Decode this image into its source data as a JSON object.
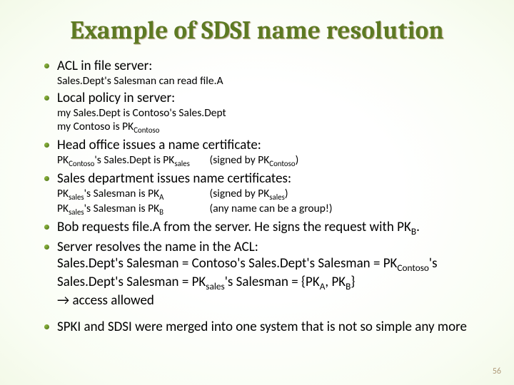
{
  "title": "Example of SDSI name resolution",
  "items": {
    "p0": "ACL in file server:",
    "s0": "Sales.Dept's Salesman can read file.A",
    "p1": "Local policy in server:",
    "s1a": "my Sales.Dept is Contoso's Sales.Dept",
    "s1b_pre": "my Contoso is PK",
    "s1b_sub": "Contoso",
    "p2": "Head office issues a name certificate:",
    "s2a_t1": "PK",
    "s2a_sub1": "Contoso",
    "s2a_t2": "'s Sales.Dept is PK",
    "s2a_sub2": "sales",
    "s2a_t3": "(signed by PK",
    "s2a_sub3": "Contoso",
    "s2a_t4": ")",
    "p3": "Sales department issues name certificates:",
    "s3a_t1": "PK",
    "s3a_sub1": "sales",
    "s3a_t2": "'s Salesman is PK",
    "s3a_sub2": "A",
    "s3a_t3": "(signed by PK",
    "s3a_sub3": "sales",
    "s3a_t4": ")",
    "s3b_t1": "PK",
    "s3b_sub1": "sales",
    "s3b_t2": "'s Salesman is PK",
    "s3b_sub2": "B",
    "s3b_t3": "(any name can be a group!)",
    "p4_t1": "Bob requests file.A from the server. He signs the request with PK",
    "p4_sub": "B",
    "p4_t2": ".",
    "p5_a": "Server resolves the name in the ACL:",
    "p5_b1": "Sales.Dept's Salesman = Contoso's Sales.Dept's Salesman = PK",
    "p5_b1_sub": "Contoso",
    "p5_b1_t2": "'s",
    "p5_c1": "Sales.Dept's Salesman = PK",
    "p5_c1_sub": "sales",
    "p5_c2": "'s Salesman = {PK",
    "p5_c2_subA": "A",
    "p5_c3": ", PK",
    "p5_c3_subB": "B",
    "p5_c4": "}",
    "p5_d": "→ access allowed",
    "p6": "SPKI and SDSI were merged into one system that is not so simple any more"
  },
  "page_number": "56"
}
